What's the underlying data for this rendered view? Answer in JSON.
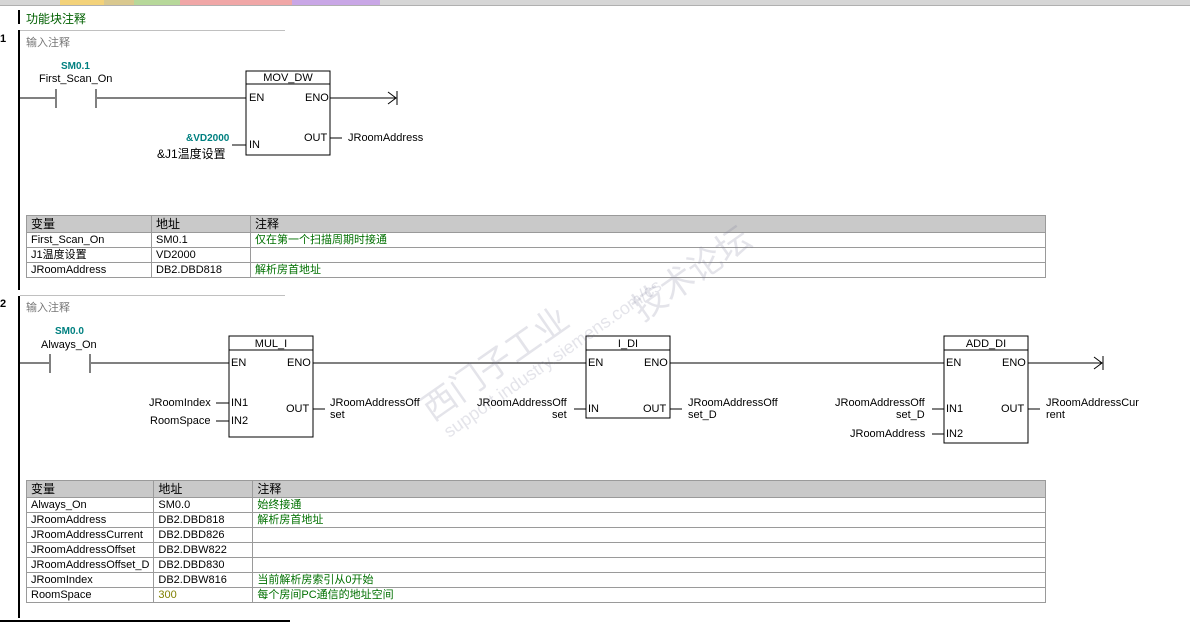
{
  "block_comment": "功能块注释",
  "networks": [
    {
      "number": "1",
      "comment": "输入注释",
      "contact": {
        "address": "SM0.1",
        "symbol": "First_Scan_On"
      },
      "box": {
        "name": "MOV_DW",
        "pins": {
          "en": "EN",
          "eno": "ENO",
          "in": "IN",
          "out": "OUT"
        },
        "in_address": "&VD2000",
        "in_symbol": "&J1温度设置",
        "out_symbol": "JRoomAddress"
      },
      "table": {
        "headers": [
          "变量",
          "地址",
          "注释"
        ],
        "rows": [
          [
            "First_Scan_On",
            "SM0.1",
            "仅在第一个扫描周期时接通"
          ],
          [
            "J1温度设置",
            "VD2000",
            ""
          ],
          [
            "JRoomAddress",
            "DB2.DBD818",
            "解析房首地址"
          ]
        ]
      }
    },
    {
      "number": "2",
      "comment": "输入注释",
      "contact": {
        "address": "SM0.0",
        "symbol": "Always_On"
      },
      "box1": {
        "name": "MUL_I",
        "pins": {
          "en": "EN",
          "eno": "ENO",
          "in1": "IN1",
          "in2": "IN2",
          "out": "OUT"
        },
        "in1_symbol": "JRoomIndex",
        "in2_symbol": "RoomSpace",
        "out_symbol_l1": "JRoomAddressOff",
        "out_symbol_l2": "set"
      },
      "box2": {
        "name": "I_DI",
        "pins": {
          "en": "EN",
          "eno": "ENO",
          "in": "IN",
          "out": "OUT"
        },
        "in_symbol_l1": "JRoomAddressOff",
        "in_symbol_l2": "set",
        "out_symbol_l1": "JRoomAddressOff",
        "out_symbol_l2": "set_D"
      },
      "box3": {
        "name": "ADD_DI",
        "pins": {
          "en": "EN",
          "eno": "ENO",
          "in1": "IN1",
          "in2": "IN2",
          "out": "OUT"
        },
        "in1_symbol_l1": "JRoomAddressOff",
        "in1_symbol_l2": "set_D",
        "in2_symbol": "JRoomAddress",
        "out_symbol_l1": "JRoomAddressCur",
        "out_symbol_l2": "rent"
      },
      "table": {
        "headers": [
          "变量",
          "地址",
          "注释"
        ],
        "rows": [
          [
            "Always_On",
            "SM0.0",
            "始终接通"
          ],
          [
            "JRoomAddress",
            "DB2.DBD818",
            "解析房首地址"
          ],
          [
            "JRoomAddressCurrent",
            "DB2.DBD826",
            ""
          ],
          [
            "JRoomAddressOffset",
            "DB2.DBW822",
            ""
          ],
          [
            "JRoomAddressOffset_D",
            "DB2.DBD830",
            ""
          ],
          [
            "JRoomIndex",
            "DB2.DBW816",
            "当前解析房索引从0开始"
          ],
          [
            "RoomSpace",
            "300",
            "每个房间PC通信的地址空间"
          ]
        ]
      }
    }
  ],
  "watermark": {
    "line1": "西门子工业",
    "line2": "技术论坛",
    "url": "support.industry.siemens.com/cs"
  },
  "colors": {
    "comment": "#006000",
    "address": "#008080",
    "constant": "#808000",
    "table_header": "#c9c9c9"
  }
}
